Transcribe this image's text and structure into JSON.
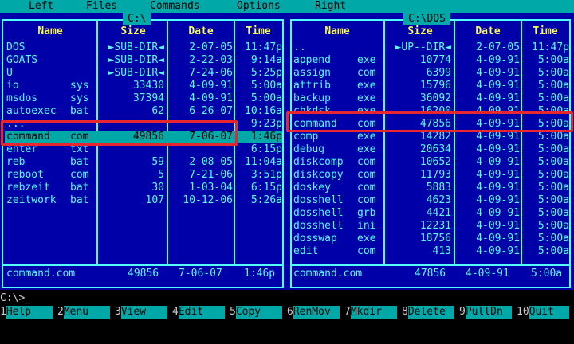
{
  "menu": [
    "Left",
    "Files",
    "Commands",
    "Options",
    "Right"
  ],
  "left_panel": {
    "title": "C:\\",
    "headers": {
      "name": "Name",
      "size": "Size",
      "date": "Date",
      "time": "Time"
    },
    "files": [
      {
        "name": "DOS",
        "ext": "",
        "size": "►SUB-DIR◄",
        "date": "2-07-05",
        "time": "11:47p"
      },
      {
        "name": "GOATS",
        "ext": "",
        "size": "►SUB-DIR◄",
        "date": "2-22-03",
        "time": "9:14a"
      },
      {
        "name": "U",
        "ext": "",
        "size": "►SUB-DIR◄",
        "date": "7-24-06",
        "time": "5:25p"
      },
      {
        "name": "io",
        "ext": "sys",
        "size": "33430",
        "date": "4-09-91",
        "time": "5:00a"
      },
      {
        "name": "msdos",
        "ext": "sys",
        "size": "37394",
        "date": "4-09-91",
        "time": "5:00a"
      },
      {
        "name": "autoexec",
        "ext": "bat",
        "size": "62",
        "date": "6-26-07",
        "time": "10:16a"
      },
      {
        "name": "...",
        "ext": "",
        "size": "",
        "date": "",
        "time": "9:23p"
      },
      {
        "name": "command",
        "ext": "com",
        "size": "49856",
        "date": "7-06-07",
        "time": "1:46p"
      },
      {
        "name": "enter",
        "ext": "txt",
        "size": "",
        "date": "",
        "time": "6:15p"
      },
      {
        "name": "reb",
        "ext": "bat",
        "size": "59",
        "date": "2-08-05",
        "time": "11:04a"
      },
      {
        "name": "reboot",
        "ext": "com",
        "size": "5",
        "date": "7-21-06",
        "time": "3:51p"
      },
      {
        "name": "rebzeit",
        "ext": "bat",
        "size": "30",
        "date": "1-03-04",
        "time": "6:15p"
      },
      {
        "name": "zeitwork",
        "ext": "bat",
        "size": "107",
        "date": "10-12-06",
        "time": "5:26a"
      }
    ],
    "footer": {
      "name": "command.com",
      "size": "49856",
      "date": "7-06-07",
      "time": "1:46p"
    }
  },
  "right_panel": {
    "title": "C:\\DOS",
    "headers": {
      "name": "Name",
      "size": "Size",
      "date": "Date",
      "time": "Time"
    },
    "files": [
      {
        "name": "..",
        "ext": "",
        "size": "►UP--DIR◄",
        "date": "2-07-05",
        "time": "11:47p"
      },
      {
        "name": "append",
        "ext": "exe",
        "size": "10774",
        "date": "4-09-91",
        "time": "5:00a"
      },
      {
        "name": "assign",
        "ext": "com",
        "size": "6399",
        "date": "4-09-91",
        "time": "5:00a"
      },
      {
        "name": "attrib",
        "ext": "exe",
        "size": "15796",
        "date": "4-09-91",
        "time": "5:00a"
      },
      {
        "name": "backup",
        "ext": "exe",
        "size": "36092",
        "date": "4-09-91",
        "time": "5:00a"
      },
      {
        "name": "chkdsk",
        "ext": "exe",
        "size": "16200",
        "date": "4-09-91",
        "time": "5:00a"
      },
      {
        "name": "command",
        "ext": "com",
        "size": "47856",
        "date": "4-09-91",
        "time": "5:00a"
      },
      {
        "name": "comp",
        "ext": "exe",
        "size": "14282",
        "date": "4-09-91",
        "time": "5:00a"
      },
      {
        "name": "debug",
        "ext": "exe",
        "size": "20634",
        "date": "4-09-91",
        "time": "5:00a"
      },
      {
        "name": "diskcomp",
        "ext": "com",
        "size": "10652",
        "date": "4-09-91",
        "time": "5:00a"
      },
      {
        "name": "diskcopy",
        "ext": "com",
        "size": "11793",
        "date": "4-09-91",
        "time": "5:00a"
      },
      {
        "name": "doskey",
        "ext": "com",
        "size": "5883",
        "date": "4-09-91",
        "time": "5:00a"
      },
      {
        "name": "dosshell",
        "ext": "com",
        "size": "4623",
        "date": "4-09-91",
        "time": "5:00a"
      },
      {
        "name": "dosshell",
        "ext": "grb",
        "size": "4421",
        "date": "4-09-91",
        "time": "5:00a"
      },
      {
        "name": "dosshell",
        "ext": "ini",
        "size": "12231",
        "date": "4-09-91",
        "time": "5:00a"
      },
      {
        "name": "dosswap",
        "ext": "exe",
        "size": "18756",
        "date": "4-09-91",
        "time": "5:00a"
      },
      {
        "name": "edit",
        "ext": "com",
        "size": "413",
        "date": "4-09-91",
        "time": "5:00a"
      }
    ],
    "footer": {
      "name": "command.com",
      "size": "47856",
      "date": "4-09-91",
      "time": "5:00a"
    }
  },
  "command_prompt": "C:\\>",
  "fkeys": [
    {
      "num": "1",
      "label": "Help"
    },
    {
      "num": "2",
      "label": "Menu"
    },
    {
      "num": "3",
      "label": "View"
    },
    {
      "num": "4",
      "label": "Edit"
    },
    {
      "num": "5",
      "label": "Copy"
    },
    {
      "num": "6",
      "label": "RenMov"
    },
    {
      "num": "7",
      "label": "Mkdir"
    },
    {
      "num": "8",
      "label": "Delete"
    },
    {
      "num": "9",
      "label": "PullDn"
    },
    {
      "num": "10",
      "label": "Quit"
    }
  ],
  "colors": {
    "panel_bg": "#0000a8",
    "text": "#54fcfc",
    "header": "#fcfc54",
    "selection": "#00a8a8",
    "highlight_box": "#e8262e"
  }
}
